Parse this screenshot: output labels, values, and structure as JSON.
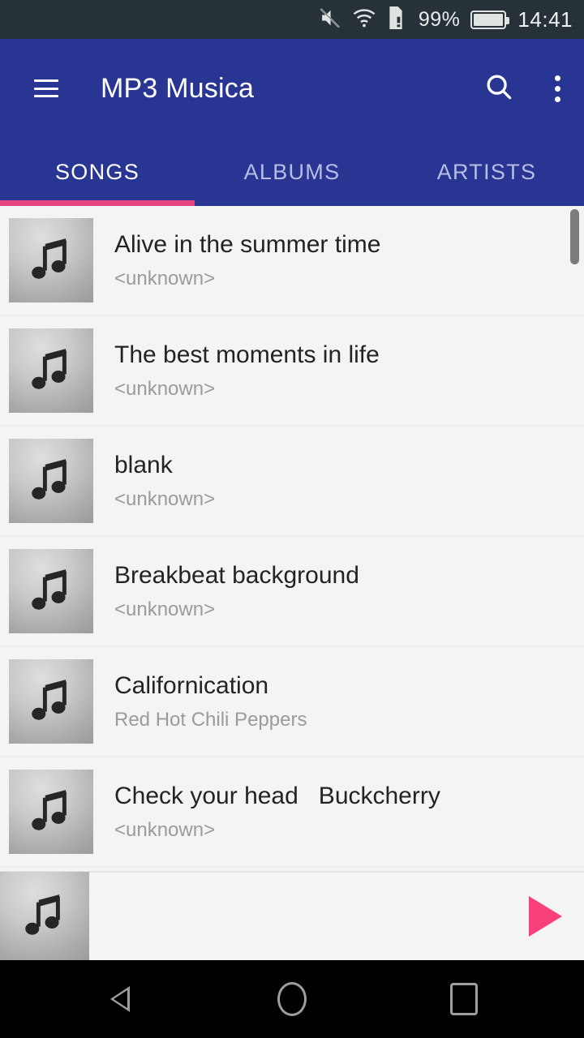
{
  "status_bar": {
    "mute_icon": "volume-mute-icon",
    "wifi_icon": "wifi-icon",
    "sim_icon": "sim-card-alert-icon",
    "battery_percent": "99%",
    "battery_icon": "battery-icon",
    "time": "14:41"
  },
  "app_bar": {
    "menu_icon": "hamburger-menu-icon",
    "title": "MP3 Musica",
    "search_icon": "search-icon",
    "overflow_icon": "overflow-menu-icon"
  },
  "tabs": {
    "items": [
      {
        "label": "SONGS",
        "active": true
      },
      {
        "label": "ALBUMS",
        "active": false
      },
      {
        "label": "ARTISTS",
        "active": false
      }
    ],
    "indicator_color": "#e5457f"
  },
  "songs": [
    {
      "title": "Alive in the summer time",
      "artist": "<unknown>",
      "art_icon": "music-note-icon"
    },
    {
      "title": "The best moments in life",
      "artist": "<unknown>",
      "art_icon": "music-note-icon"
    },
    {
      "title": "blank",
      "artist": "<unknown>",
      "art_icon": "music-note-icon"
    },
    {
      "title": "Breakbeat background",
      "artist": "<unknown>",
      "art_icon": "music-note-icon"
    },
    {
      "title": "Californication",
      "artist": "Red Hot Chili Peppers",
      "art_icon": "music-note-icon"
    },
    {
      "title": "Check your head   Buckcherry",
      "artist": "<unknown>",
      "art_icon": "music-note-icon"
    }
  ],
  "player": {
    "art_icon": "music-note-icon",
    "title": "",
    "artist": "",
    "play_icon": "play-icon",
    "play_color": "#f8417a"
  },
  "nav_bar": {
    "back_icon": "back-triangle-icon",
    "home_icon": "home-circle-icon",
    "recents_icon": "recents-square-icon"
  },
  "colors": {
    "status_bar": "#263238",
    "app_bar": "#283593",
    "accent": "#e5457f",
    "list_background": "#f4f4f4"
  }
}
